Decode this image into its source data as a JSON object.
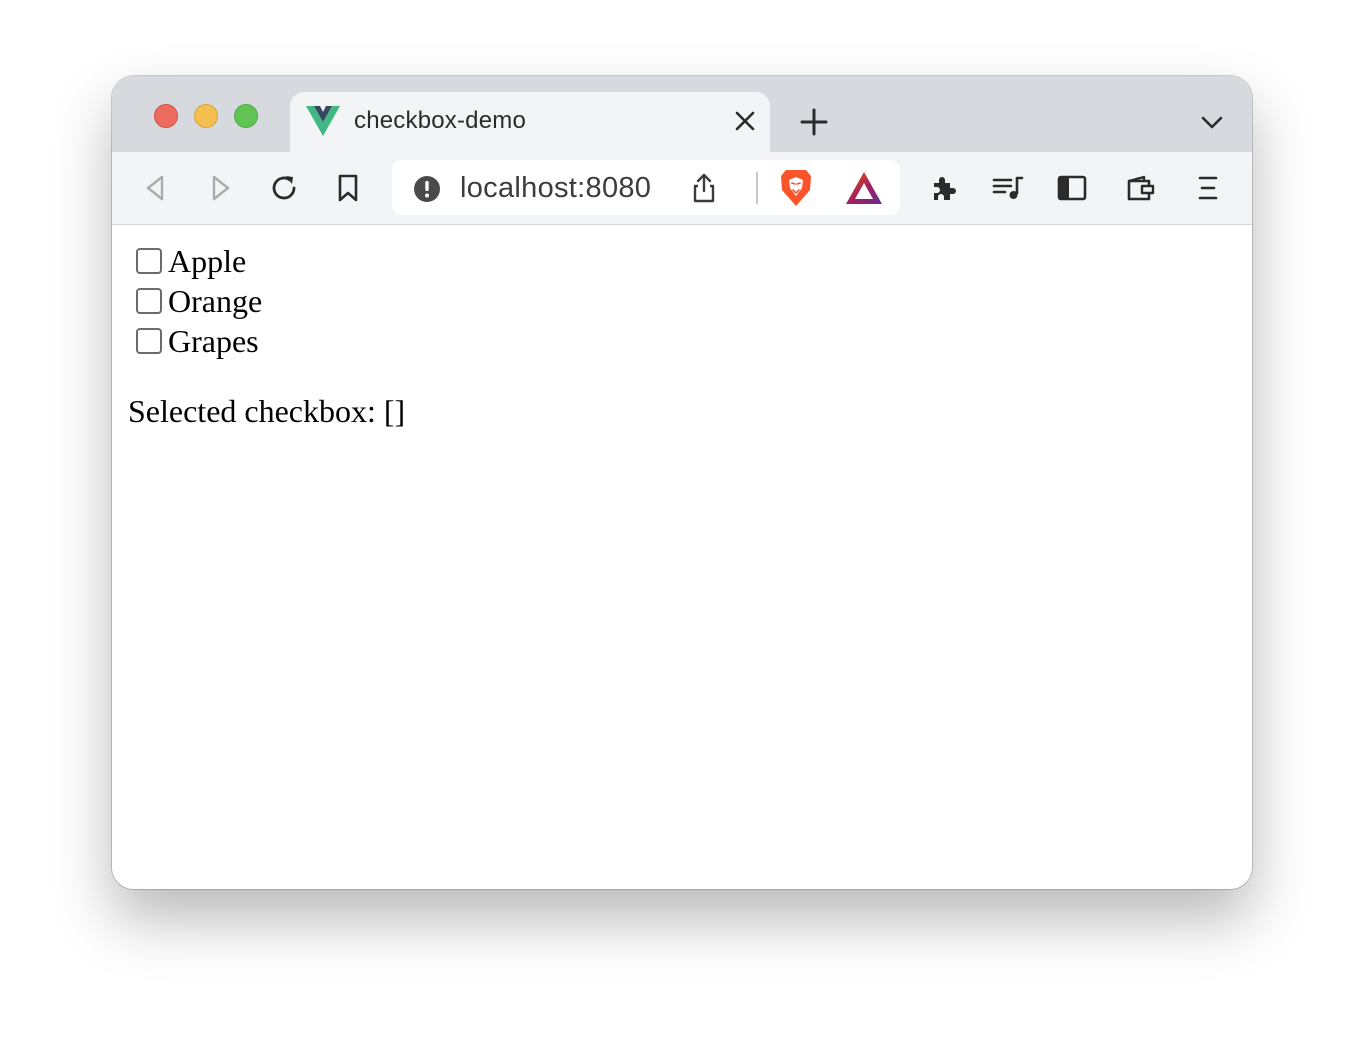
{
  "browser": {
    "tab": {
      "title": "checkbox-demo",
      "favicon": "vue-logo-icon"
    },
    "address": {
      "url": "localhost:8080"
    },
    "colors": {
      "tabbar": "#d6dadf",
      "toolbar": "#f3f4f5",
      "vue_green": "#41b883",
      "vue_dark": "#35495e",
      "brave_orange": "#fb542b"
    }
  },
  "page": {
    "checkboxes": [
      {
        "label": "Apple",
        "checked": false
      },
      {
        "label": "Orange",
        "checked": false
      },
      {
        "label": "Grapes",
        "checked": false
      }
    ],
    "selected_text": "Selected checkbox: []"
  }
}
